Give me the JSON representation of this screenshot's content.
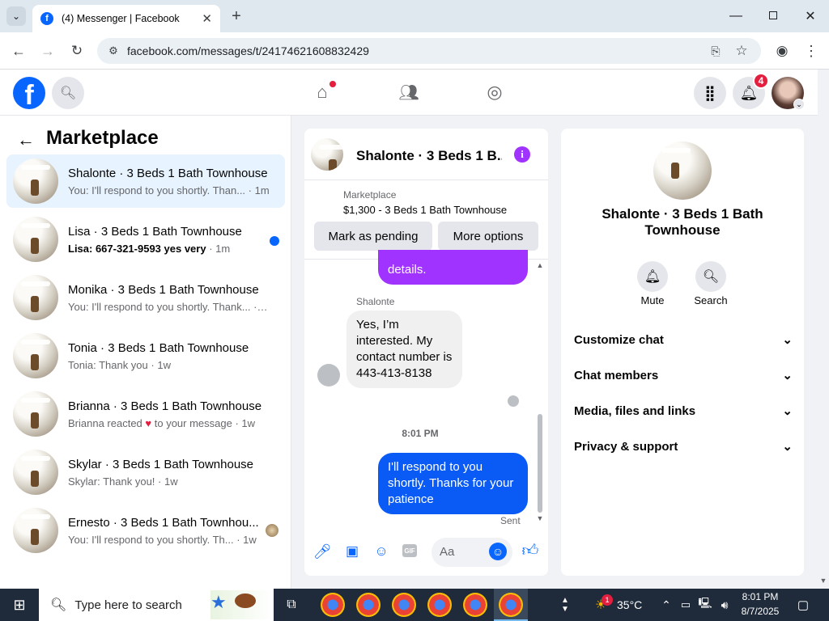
{
  "browser": {
    "tab_title": "(4) Messenger | Facebook",
    "url": "facebook.com/messages/t/24174621608832429"
  },
  "nav": {
    "notifications_badge": "4"
  },
  "sidebar": {
    "title": "Marketplace",
    "conversations": [
      {
        "name": "Shalonte · 3 Beds 1 Bath Townhouse",
        "preview": "You: I'll respond to you shortly. Than...",
        "time": "· 1m",
        "active": true,
        "unread": false
      },
      {
        "name": "Lisa · 3 Beds 1 Bath Townhouse",
        "preview": "Lisa: 667-321-9593 yes very",
        "time": "· 1m",
        "active": false,
        "unread": true
      },
      {
        "name": "Monika · 3 Beds 1 Bath Townhouse",
        "preview": "You: I'll respond to you shortly. Thank...",
        "time": "· 1w",
        "active": false,
        "unread": false
      },
      {
        "name": "Tonia · 3 Beds 1 Bath Townhouse",
        "preview": "Tonia: Thank you",
        "time": "· 1w",
        "active": false,
        "unread": false
      },
      {
        "name": "Brianna · 3 Beds 1 Bath Townhouse",
        "preview": "Brianna reacted",
        "preview_suffix": "to your message",
        "time": "· 1w",
        "active": false,
        "unread": false
      },
      {
        "name": "Skylar · 3 Beds 1 Bath Townhouse",
        "preview": "Skylar: Thank you!",
        "time": "· 1w",
        "active": false,
        "unread": false
      },
      {
        "name": "Ernesto · 3 Beds 1 Bath Townhou...",
        "preview": "You: I'll respond to you shortly. Th...",
        "time": "· 1w",
        "active": false,
        "unread": false
      }
    ]
  },
  "chat": {
    "header_title": "Shalonte · 3 Beds 1 B...",
    "marketplace_label": "Marketplace",
    "listing": "$1,300 - 3 Beds 1 Bath Townhouse",
    "btn_pending": "Mark as pending",
    "btn_more": "More options",
    "prev_bubble_tail": "details.",
    "sender_name": "Shalonte",
    "incoming": "Yes, I’m interested. My contact number is 443-413-8138",
    "timestamp": "8:01 PM",
    "outgoing": "I'll respond to you shortly. Thanks for your patience",
    "sent_status": "Sent",
    "composer_placeholder": "Aa"
  },
  "info": {
    "title": "Shalonte · 3 Beds 1 Bath Townhouse",
    "mute_label": "Mute",
    "search_label": "Search",
    "sections": [
      "Customize chat",
      "Chat members",
      "Media, files and links",
      "Privacy & support"
    ]
  },
  "taskbar": {
    "search_placeholder": "Type here to search",
    "weather": "35°C",
    "weather_badge": "1",
    "time": "8:01 PM",
    "date": "8/7/2025"
  },
  "colors": {
    "fb_blue": "#0866ff",
    "outgoing_bubble": "#0a5af5",
    "purple_bubble": "#a033ff",
    "active_row": "#e7f3ff",
    "badge_red": "#e41e3f"
  }
}
